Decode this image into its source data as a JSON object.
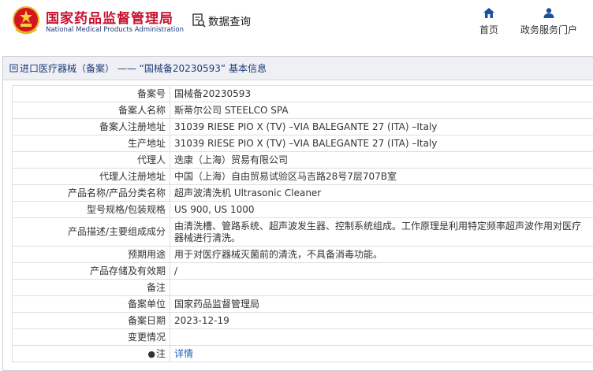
{
  "header": {
    "agency_cn": "国家药品监督管理局",
    "agency_en": "National Medical Products Administration",
    "data_query_label": "数据查询",
    "nav": [
      {
        "label": "首页",
        "icon": "home-icon"
      },
      {
        "label": "政务服务门户",
        "icon": "user-icon"
      }
    ]
  },
  "panel": {
    "title": "进口医疗器械（备案） —— “国械备20230593” 基本信息"
  },
  "record": {
    "rows": [
      {
        "label": "备案号",
        "value": "国械备20230593"
      },
      {
        "label": "备案人名称",
        "value": "斯蒂尔公司 STEELCO SPA"
      },
      {
        "label": "备案人注册地址",
        "value": "31039 RIESE PIO X (TV) –VIA BALEGANTE 27 (ITA) –Italy"
      },
      {
        "label": "生产地址",
        "value": "31039 RIESE PIO X (TV) –VIA BALEGANTE 27 (ITA) –Italy"
      },
      {
        "label": "代理人",
        "value": "迭康（上海）贸易有限公司"
      },
      {
        "label": "代理人注册地址",
        "value": "中国（上海）自由贸易试验区马吉路28号7层707B室"
      },
      {
        "label": "产品名称/产品分类名称",
        "value": "超声波清洗机 Ultrasonic Cleaner"
      },
      {
        "label": "型号规格/包装规格",
        "value": "US 900, US 1000"
      },
      {
        "label": "产品描述/主要组成成分",
        "value": "由清洗槽、管路系统、超声波发生器、控制系统组成。工作原理是利用特定频率超声波作用对医疗器械进行清洗。"
      },
      {
        "label": "预期用途",
        "value": "用于对医疗器械灭菌前的清洗，不具备消毒功能。"
      },
      {
        "label": "产品存储及有效期",
        "value": "/"
      },
      {
        "label": "备注",
        "value": ""
      },
      {
        "label": "备案单位",
        "value": "国家药品监督管理局"
      },
      {
        "label": "备案日期",
        "value": "2023-12-19"
      },
      {
        "label": "变更情况",
        "value": ""
      }
    ],
    "note_label": "注",
    "note_link": "详情"
  },
  "colors": {
    "brand_red": "#c8102e",
    "brand_blue": "#1f3b7a",
    "link_blue": "#1f5fbf"
  }
}
